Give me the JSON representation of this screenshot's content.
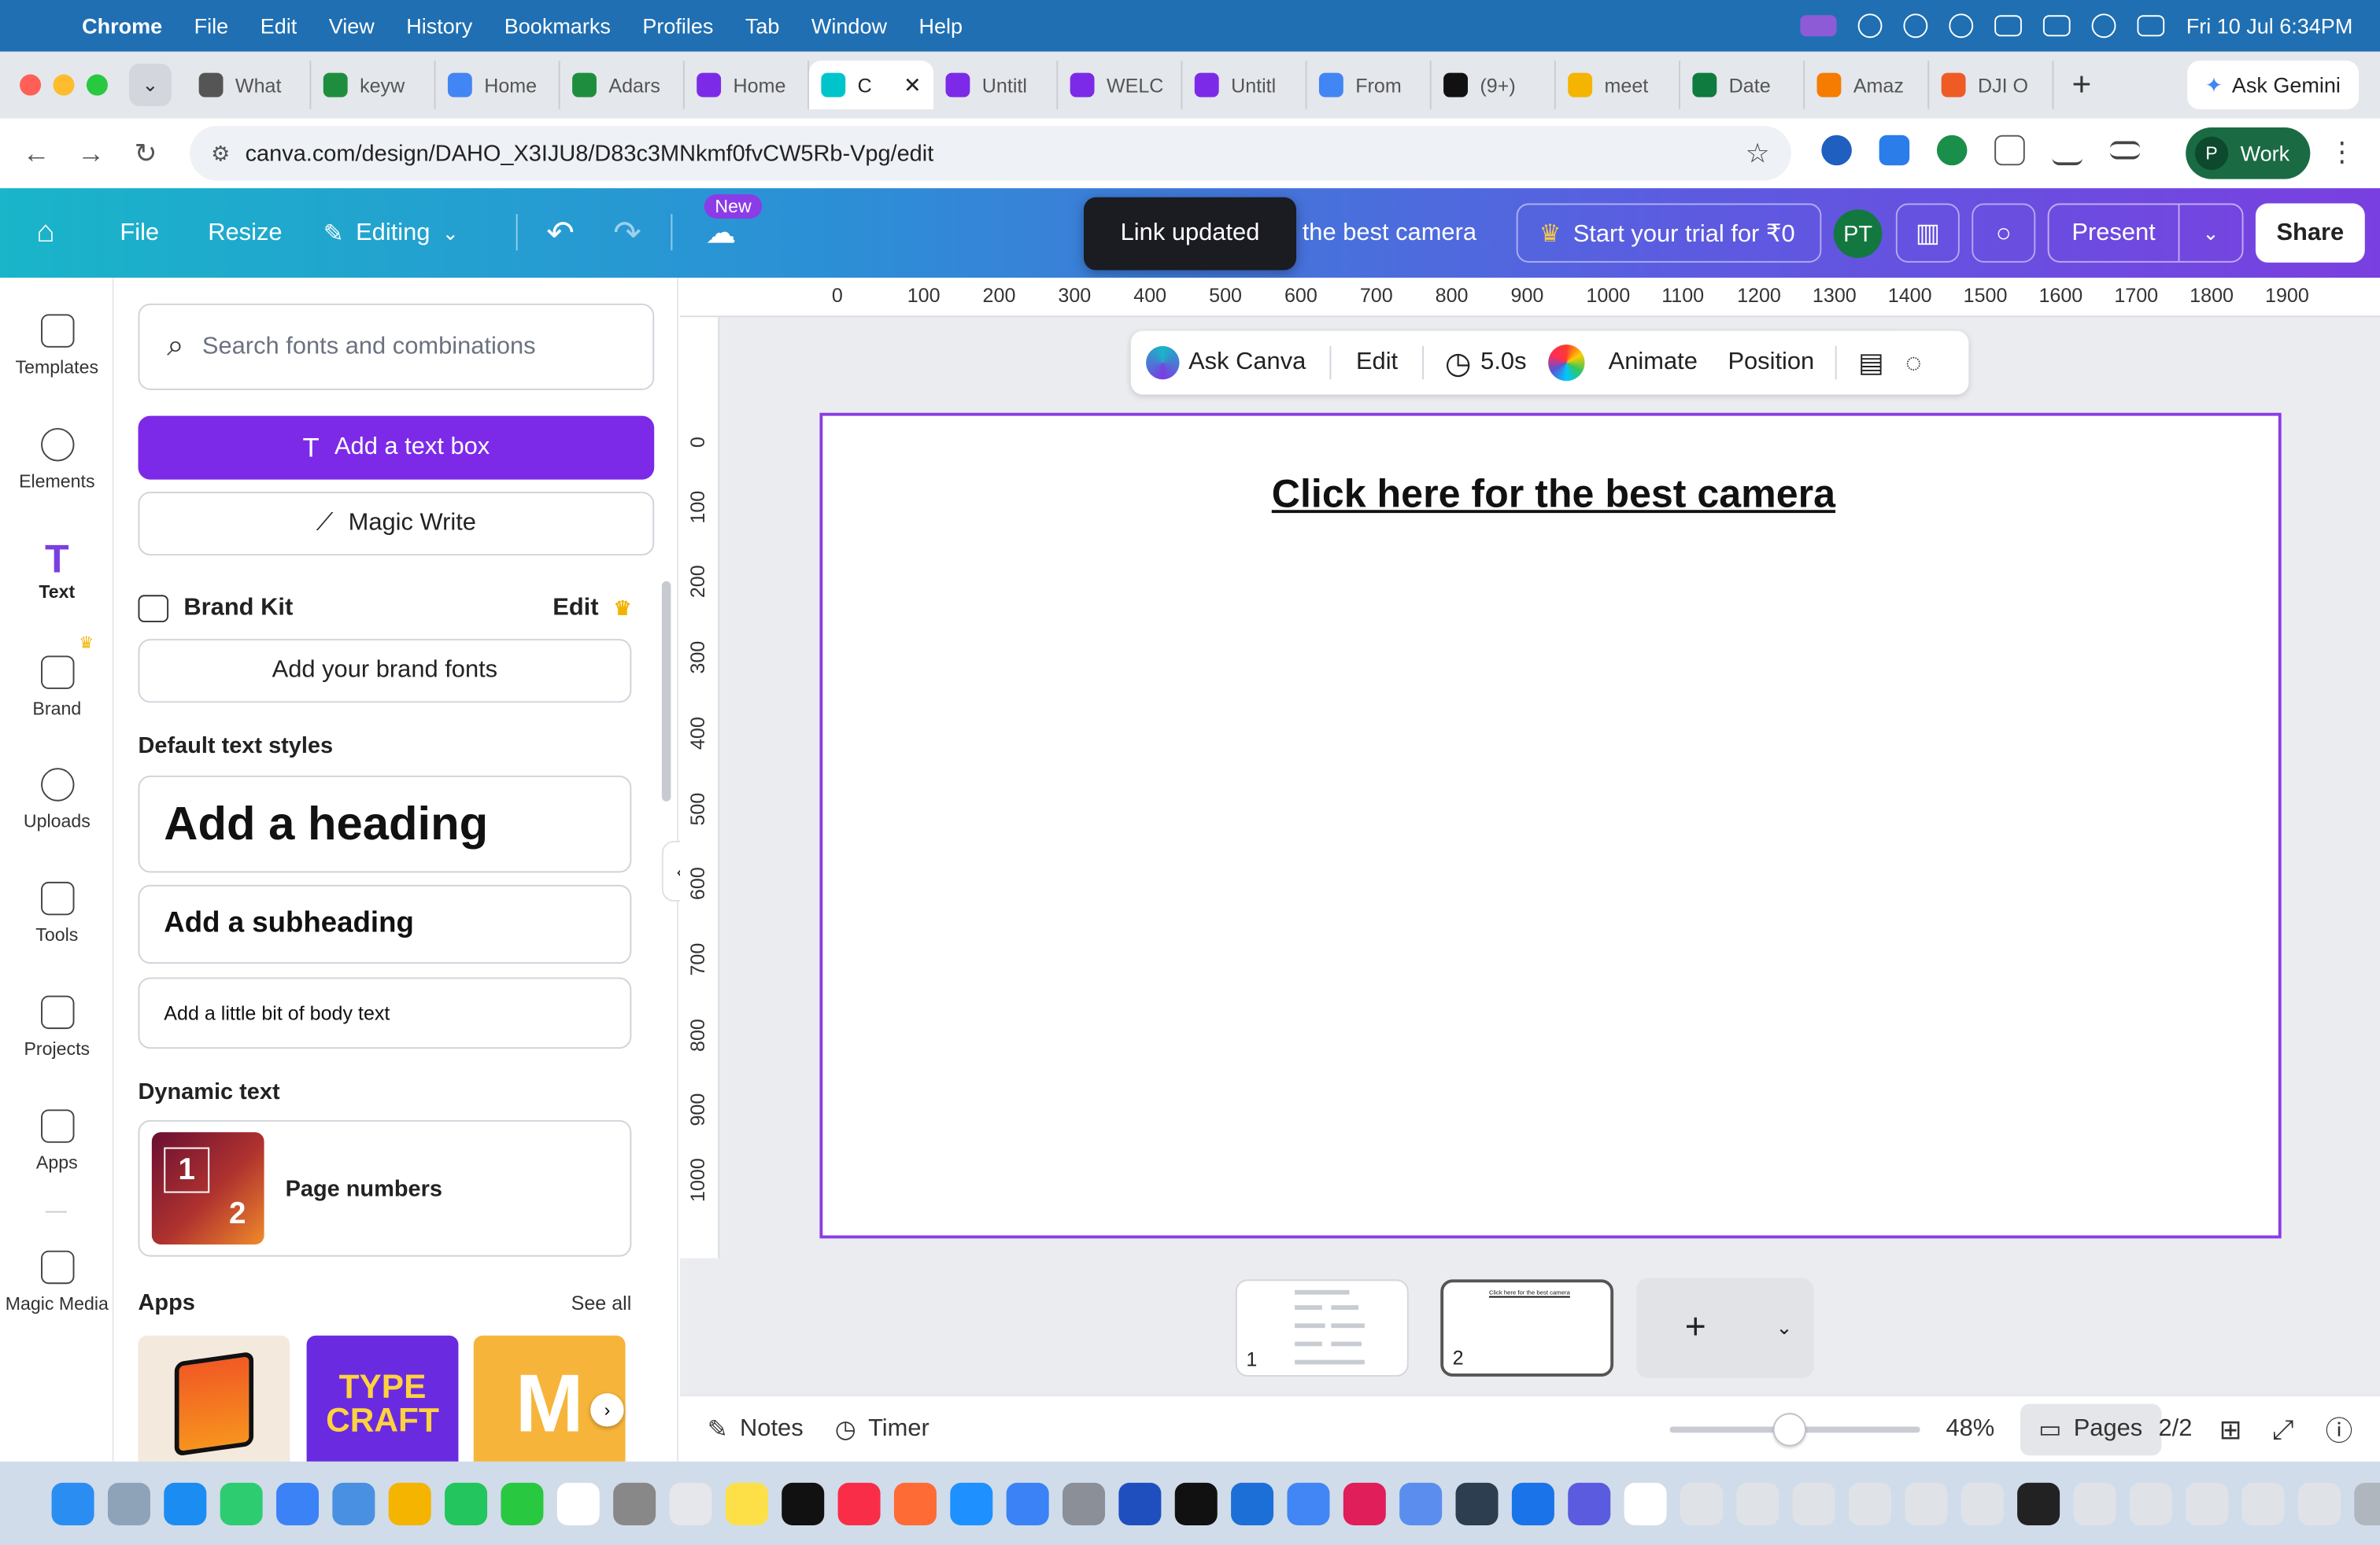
{
  "menubar": {
    "apple": "",
    "app": "Chrome",
    "items": [
      "File",
      "Edit",
      "View",
      "History",
      "Bookmarks",
      "Profiles",
      "Tab",
      "Window",
      "Help"
    ],
    "datetime": "Fri 10 Jul  6:34PM"
  },
  "tabs": [
    {
      "label": "What",
      "color": "#555555"
    },
    {
      "label": "keyw",
      "color": "#1e8e3e"
    },
    {
      "label": "Home",
      "color": "#4285f4"
    },
    {
      "label": "Adars",
      "color": "#1e8e3e"
    },
    {
      "label": "Home",
      "color": "#7d2ae8"
    },
    {
      "label": "C",
      "color": "#00c4cc",
      "active": true
    },
    {
      "label": "Untitl",
      "color": "#7d2ae8"
    },
    {
      "label": "WELC",
      "color": "#7d2ae8"
    },
    {
      "label": "Untitl",
      "color": "#7d2ae8"
    },
    {
      "label": "From",
      "color": "#4285f4"
    },
    {
      "label": "(9+) ",
      "color": "#111111"
    },
    {
      "label": "meet",
      "color": "#f4b400"
    },
    {
      "label": "Date",
      "color": "#0f7b3f"
    },
    {
      "label": "Amaz",
      "color": "#f57c00"
    },
    {
      "label": "DJI O",
      "color": "#ef5b25"
    }
  ],
  "browser": {
    "ask_gemini": "Ask Gemini",
    "url": "canva.com/design/DAHO_X3IJU8/D83c3MNkmf0fvCW5Rb-Vpg/edit",
    "profile_initial": "P",
    "profile_label": "Work"
  },
  "canva": {
    "file": "File",
    "resize": "Resize",
    "editing": "Editing",
    "new_badge": "New",
    "toast": "Link updated",
    "design_title": "the best camera",
    "trial": "Start your trial for ₹0",
    "avatar": "PT",
    "present": "Present",
    "share": "Share"
  },
  "rail": [
    {
      "label": "Templates",
      "name": "templates"
    },
    {
      "label": "Elements",
      "name": "elements"
    },
    {
      "label": "Text",
      "name": "text"
    },
    {
      "label": "Brand",
      "name": "brand"
    },
    {
      "label": "Uploads",
      "name": "uploads"
    },
    {
      "label": "Tools",
      "name": "tools"
    },
    {
      "label": "Projects",
      "name": "projects"
    },
    {
      "label": "Apps",
      "name": "apps"
    },
    {
      "label": "Magic Media",
      "name": "magic-media"
    }
  ],
  "panel": {
    "search_placeholder": "Search fonts and combinations",
    "add_text_box": "Add a text box",
    "magic_write": "Magic Write",
    "brand_kit": "Brand Kit",
    "brand_edit": "Edit",
    "add_brand_fonts": "Add your brand fonts",
    "default_styles": "Default text styles",
    "heading": "Add a heading",
    "subheading": "Add a subheading",
    "body": "Add a little bit of body text",
    "dynamic_text": "Dynamic text",
    "page_numbers": "Page numbers",
    "pn_one": "1",
    "pn_two": "2",
    "apps": "Apps",
    "see_all": "See all",
    "app2": "TYPE CRAFT",
    "app3": "M"
  },
  "ruler": {
    "h": [
      "0",
      "100",
      "200",
      "300",
      "400",
      "500",
      "600",
      "700",
      "800",
      "900",
      "1000",
      "1100",
      "1200",
      "1300",
      "1400",
      "1500",
      "1600",
      "1700",
      "1800",
      "1900"
    ],
    "v": [
      "0",
      "100",
      "200",
      "300",
      "400",
      "500",
      "600",
      "700",
      "800",
      "900",
      "1000"
    ]
  },
  "toolbar": {
    "ask_canva": "Ask Canva",
    "edit": "Edit",
    "duration": "5.0s",
    "animate": "Animate",
    "position": "Position"
  },
  "page": {
    "text": "Click here for the best camera"
  },
  "thumbnails": [
    {
      "number": "1"
    },
    {
      "number": "2",
      "caption": "Click here for the best camera"
    }
  ],
  "footer": {
    "notes": "Notes",
    "timer": "Timer",
    "zoom": "48%",
    "zoom_level": 0.48,
    "pages": "Pages",
    "page_count": "2/2"
  }
}
